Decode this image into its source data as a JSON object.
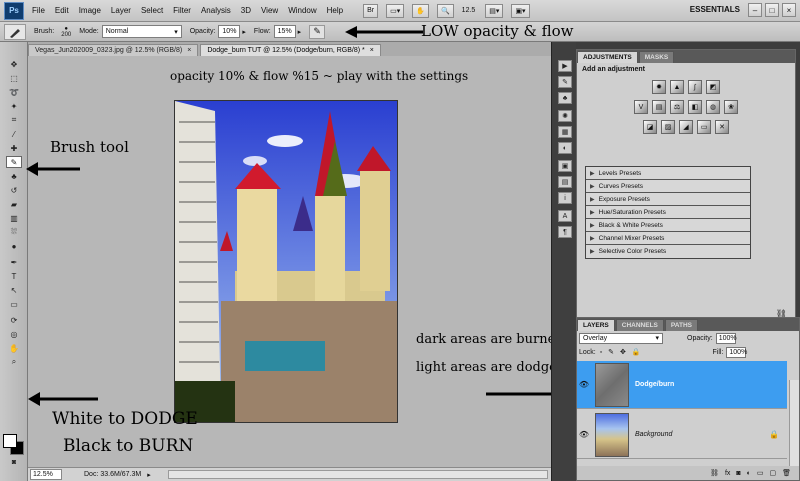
{
  "app": {
    "logo": "Ps",
    "menu": [
      "File",
      "Edit",
      "Image",
      "Layer",
      "Select",
      "Filter",
      "Analysis",
      "3D",
      "View",
      "Window",
      "Help"
    ],
    "bridge_label": "Br",
    "zoom": "12.5",
    "workspace": "ESSENTIALS",
    "window_controls": [
      "–",
      "□",
      "×"
    ]
  },
  "options": {
    "brush_label": "Brush:",
    "brush_size": "200",
    "mode_label": "Mode:",
    "mode_value": "Normal",
    "opacity_label": "Opacity:",
    "opacity_value": "10%",
    "flow_label": "Flow:",
    "flow_value": "15%"
  },
  "tabs": [
    {
      "label": "Vegas_Jun202009_0323.jpg @ 12.5% (RGB/8)",
      "active": false
    },
    {
      "label": "Dodge_burn TUT @ 12.5% (Dodge/burn, RGB/8) *",
      "active": true
    }
  ],
  "status": {
    "zoom": "12.5%",
    "doc": "Doc: 33.6M/67.3M"
  },
  "annotations": {
    "low_opacity": "LOW opacity & flow",
    "settings": "opacity 10% & flow %15 ~ play with the settings",
    "brush_tool": "Brush tool",
    "dark_burned": "dark areas are burned",
    "light_dodged": "light areas are dodged",
    "white_dodge": "White to DODGE",
    "black_burn": "Black to BURN"
  },
  "adjustments": {
    "tabs": [
      "ADJUSTMENTS",
      "MASKS"
    ],
    "title": "Add an adjustment",
    "presets": [
      "Levels Presets",
      "Curves Presets",
      "Exposure Presets",
      "Hue/Saturation Presets",
      "Black & White Presets",
      "Channel Mixer Presets",
      "Selective Color Presets"
    ]
  },
  "layers": {
    "tabs": [
      "LAYERS",
      "CHANNELS",
      "PATHS"
    ],
    "blend_mode": "Overlay",
    "opacity_label": "Opacity:",
    "opacity_value": "100%",
    "lock_label": "Lock:",
    "fill_label": "Fill:",
    "fill_value": "100%",
    "items": [
      {
        "name": "Dodge/burn",
        "selected": true
      },
      {
        "name": "Background",
        "selected": false
      }
    ]
  },
  "colors": {
    "selected_layer": "#3d9df0",
    "canvas_bg": "#b7b7b7",
    "panel_bg": "#cfcfcf"
  }
}
